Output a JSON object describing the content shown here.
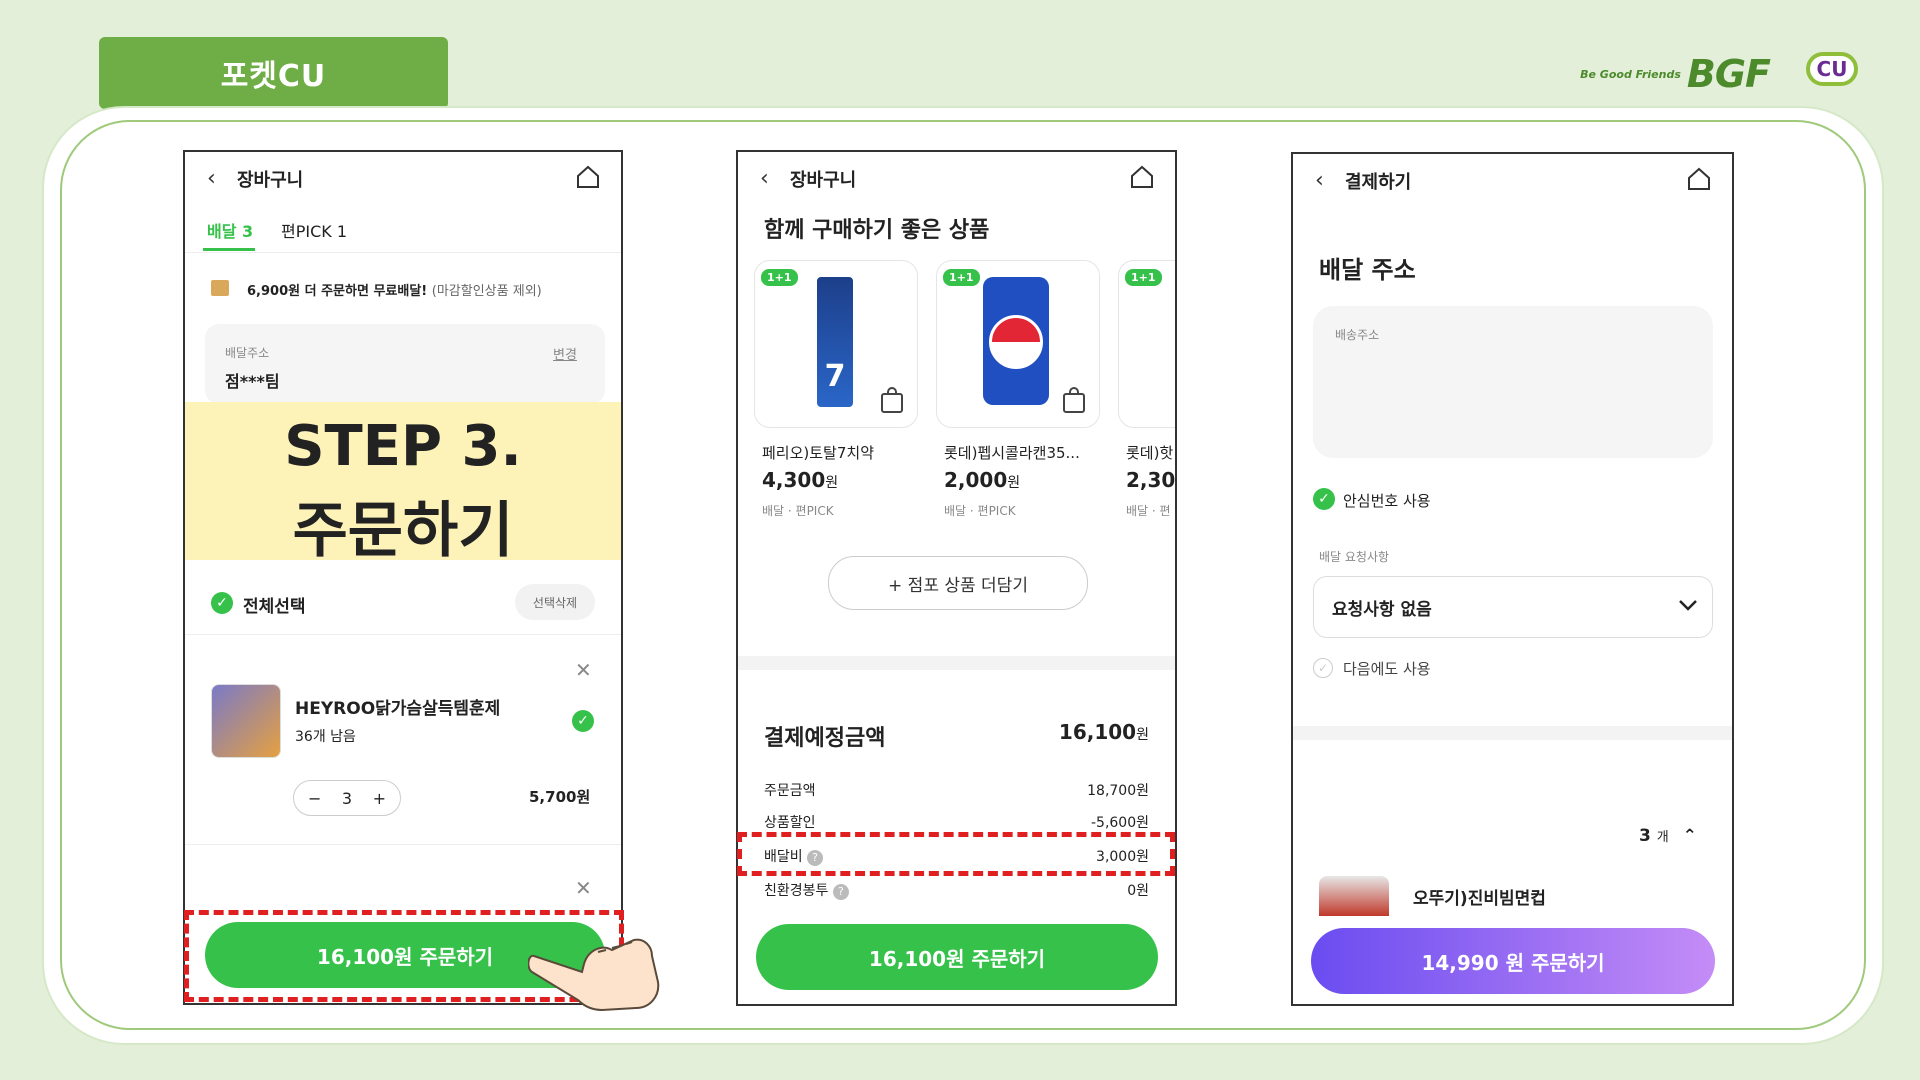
{
  "page_title": "포켓CU",
  "brand": {
    "tagline": "Be Good Friends",
    "bgf": "BGF",
    "cu": "CU"
  },
  "screen1": {
    "header_title": "장바구니",
    "tabs": [
      {
        "label": "배달 3"
      },
      {
        "label": "편PICK 1"
      }
    ],
    "notice": "6,900원 더 주문하면 무료배달!",
    "notice_sub": "(마감할인상품 제외)",
    "address_label": "배달주소",
    "address_change": "변경",
    "address_value": "점***팀",
    "step_title": "STEP 3.",
    "step_subtitle": "주문하기",
    "select_all": "전체선택",
    "delete_selected": "선택삭제",
    "item_name": "HEYROO닭가슴살득템훈제",
    "item_stock": "36개 남음",
    "item_qty": "3",
    "item_price": "5,700원",
    "order_button": "16,100원 주문하기"
  },
  "screen2": {
    "header_title": "장바구니",
    "section_title": "함께 구매하기 좋은 상품",
    "products": [
      {
        "badge": "1+1",
        "name": "페리오)토탈7치약",
        "price": "4,300",
        "unit": "원",
        "tag": "배달 · 편PICK"
      },
      {
        "badge": "1+1",
        "name": "롯데)펩시콜라캔35...",
        "price": "2,000",
        "unit": "원",
        "tag": "배달 · 편PICK"
      },
      {
        "badge": "1+1",
        "name": "롯데)핫",
        "price": "2,30",
        "unit": "",
        "tag": "배달 · 편"
      }
    ],
    "add_more": "+ 점포 상품 더담기",
    "total_label": "결제예정금액",
    "total_value": "16,100",
    "total_unit": "원",
    "rows": [
      {
        "label": "주문금액",
        "value": "18,700원"
      },
      {
        "label": "상품할인",
        "value": "-5,600원"
      },
      {
        "label": "배달비",
        "value": "3,000원"
      },
      {
        "label": "친환경봉투",
        "value": "0원"
      }
    ],
    "order_button": "16,100원 주문하기"
  },
  "screen3": {
    "header_title": "결제하기",
    "section_title": "배달 주소",
    "address_placeholder": "배송주소",
    "safe_number": "안심번호 사용",
    "request_label": "배달 요청사항",
    "request_value": "요청사항 없음",
    "use_next": "다음에도 사용",
    "count": "3",
    "count_unit": "개",
    "item_name": "오뚜기)진비빔면컵",
    "order_button": "14,990 원 주문하기"
  },
  "colors": {
    "accent_green": "#36c24a",
    "title_green": "#6fae46",
    "highlight_yellow": "#fdf3b8",
    "dash_red": "#e02020",
    "purple_start": "#6a4cf0",
    "purple_end": "#c48cf6"
  }
}
